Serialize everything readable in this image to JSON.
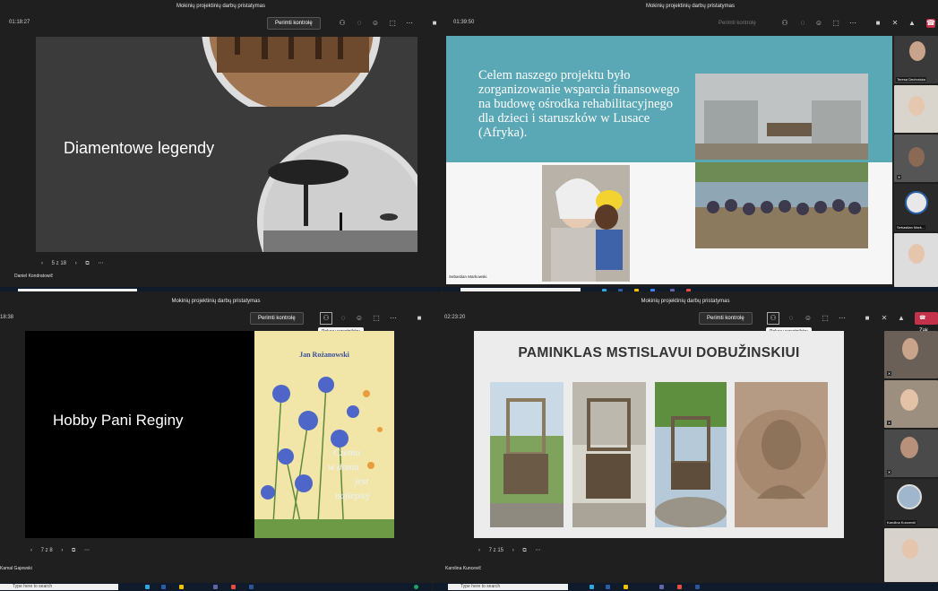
{
  "window_title": "Mokinių projektinių darbų pristatymas",
  "take_control_label": "Perimti kontrolę",
  "show_participants_tooltip": "Pokaz uczestników",
  "taskbar_search": "Type here to search",
  "q1": {
    "timer": "01:18:27",
    "slide_title": "Diamentowe legendy",
    "page": "5 z 18",
    "presenter": "Daniel Kondratowič"
  },
  "q2": {
    "timer": "01:39:50",
    "slide_text": "Celem naszego projektu było zorganizowanie wsparcia finansowego na budowę ośrodka rehabilitacyjnego dla dzieci i staruszków w Lusace (Afryka).",
    "presenter": "Sebastian Markowski",
    "participants": [
      "Teresa Dechnicka",
      "Sebastian Mark..."
    ]
  },
  "q3": {
    "timer": "18:38",
    "slide_title": "Hobby Pani Reginy",
    "book_author": "Jan Rożanowski",
    "book_title_lines": [
      "Czemu",
      "w domu",
      "jest",
      "najlepiej"
    ],
    "page": "7 z 8",
    "presenter": "Kamal Gajewski"
  },
  "q4": {
    "timer": "02:23:20",
    "leave_label": "Zak",
    "slide_title": "PAMINKLAS MSTISLAVUI DOBUŽINSKIUI",
    "page": "7 z 15",
    "presenter": "Karolina Kuncevič",
    "participants": [
      "Karolina Kuncevič"
    ]
  }
}
